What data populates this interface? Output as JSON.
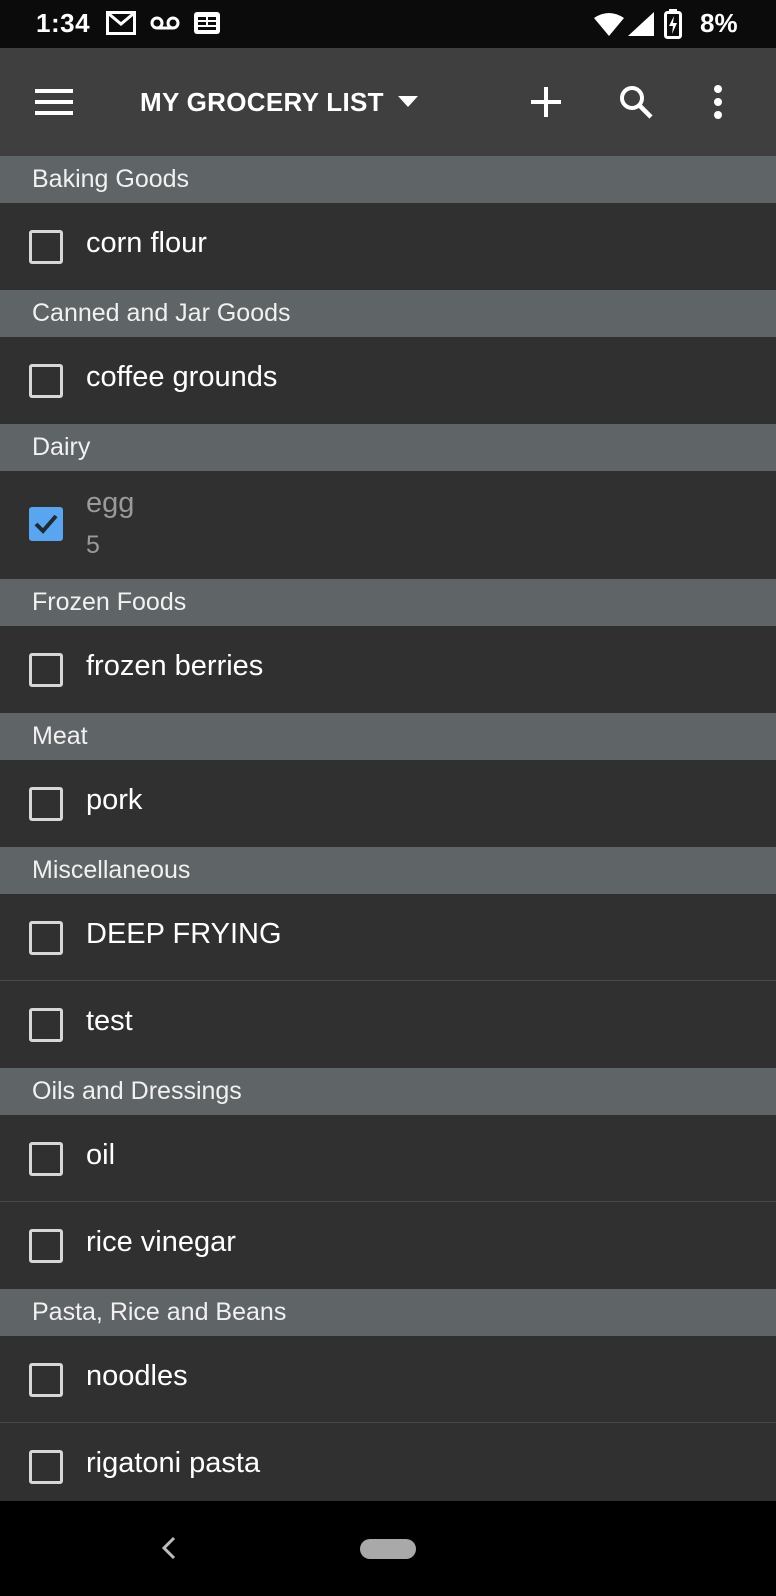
{
  "status_bar": {
    "time": "1:34",
    "battery": "8%",
    "icons": [
      "gmail-icon",
      "voicemail-icon",
      "news-icon",
      "wifi-icon",
      "signal-icon",
      "battery-charging-icon"
    ]
  },
  "app_bar": {
    "title": "MY GROCERY LIST",
    "icons": [
      "menu-icon",
      "dropdown-arrow-icon",
      "add-icon",
      "search-icon",
      "more-vert-icon"
    ]
  },
  "colors": {
    "status_bar": "#0b0b0b",
    "app_bar": "#3f3f3f",
    "section_header": "#5f6466",
    "list_background": "#303030",
    "checkbox_checked": "#5aa5f0"
  },
  "sections": [
    {
      "name": "Baking Goods",
      "items": [
        {
          "name": "corn flour",
          "checked": false
        }
      ]
    },
    {
      "name": "Canned and Jar Goods",
      "items": [
        {
          "name": "coffee grounds",
          "checked": false
        }
      ]
    },
    {
      "name": "Dairy",
      "items": [
        {
          "name": "egg",
          "quantity": "5",
          "checked": true
        }
      ]
    },
    {
      "name": "Frozen Foods",
      "items": [
        {
          "name": "frozen berries",
          "checked": false
        }
      ]
    },
    {
      "name": "Meat",
      "items": [
        {
          "name": "pork",
          "checked": false
        }
      ]
    },
    {
      "name": "Miscellaneous",
      "items": [
        {
          "name": "DEEP FRYING",
          "checked": false
        },
        {
          "name": "test",
          "checked": false
        }
      ]
    },
    {
      "name": "Oils and Dressings",
      "items": [
        {
          "name": "oil",
          "checked": false
        },
        {
          "name": "rice vinegar",
          "checked": false
        }
      ]
    },
    {
      "name": "Pasta, Rice and Beans",
      "items": [
        {
          "name": "noodles",
          "checked": false
        },
        {
          "name": "rigatoni pasta",
          "checked": false
        }
      ]
    }
  ],
  "nav_bar": {
    "icons": [
      "back-icon",
      "home-pill"
    ]
  }
}
